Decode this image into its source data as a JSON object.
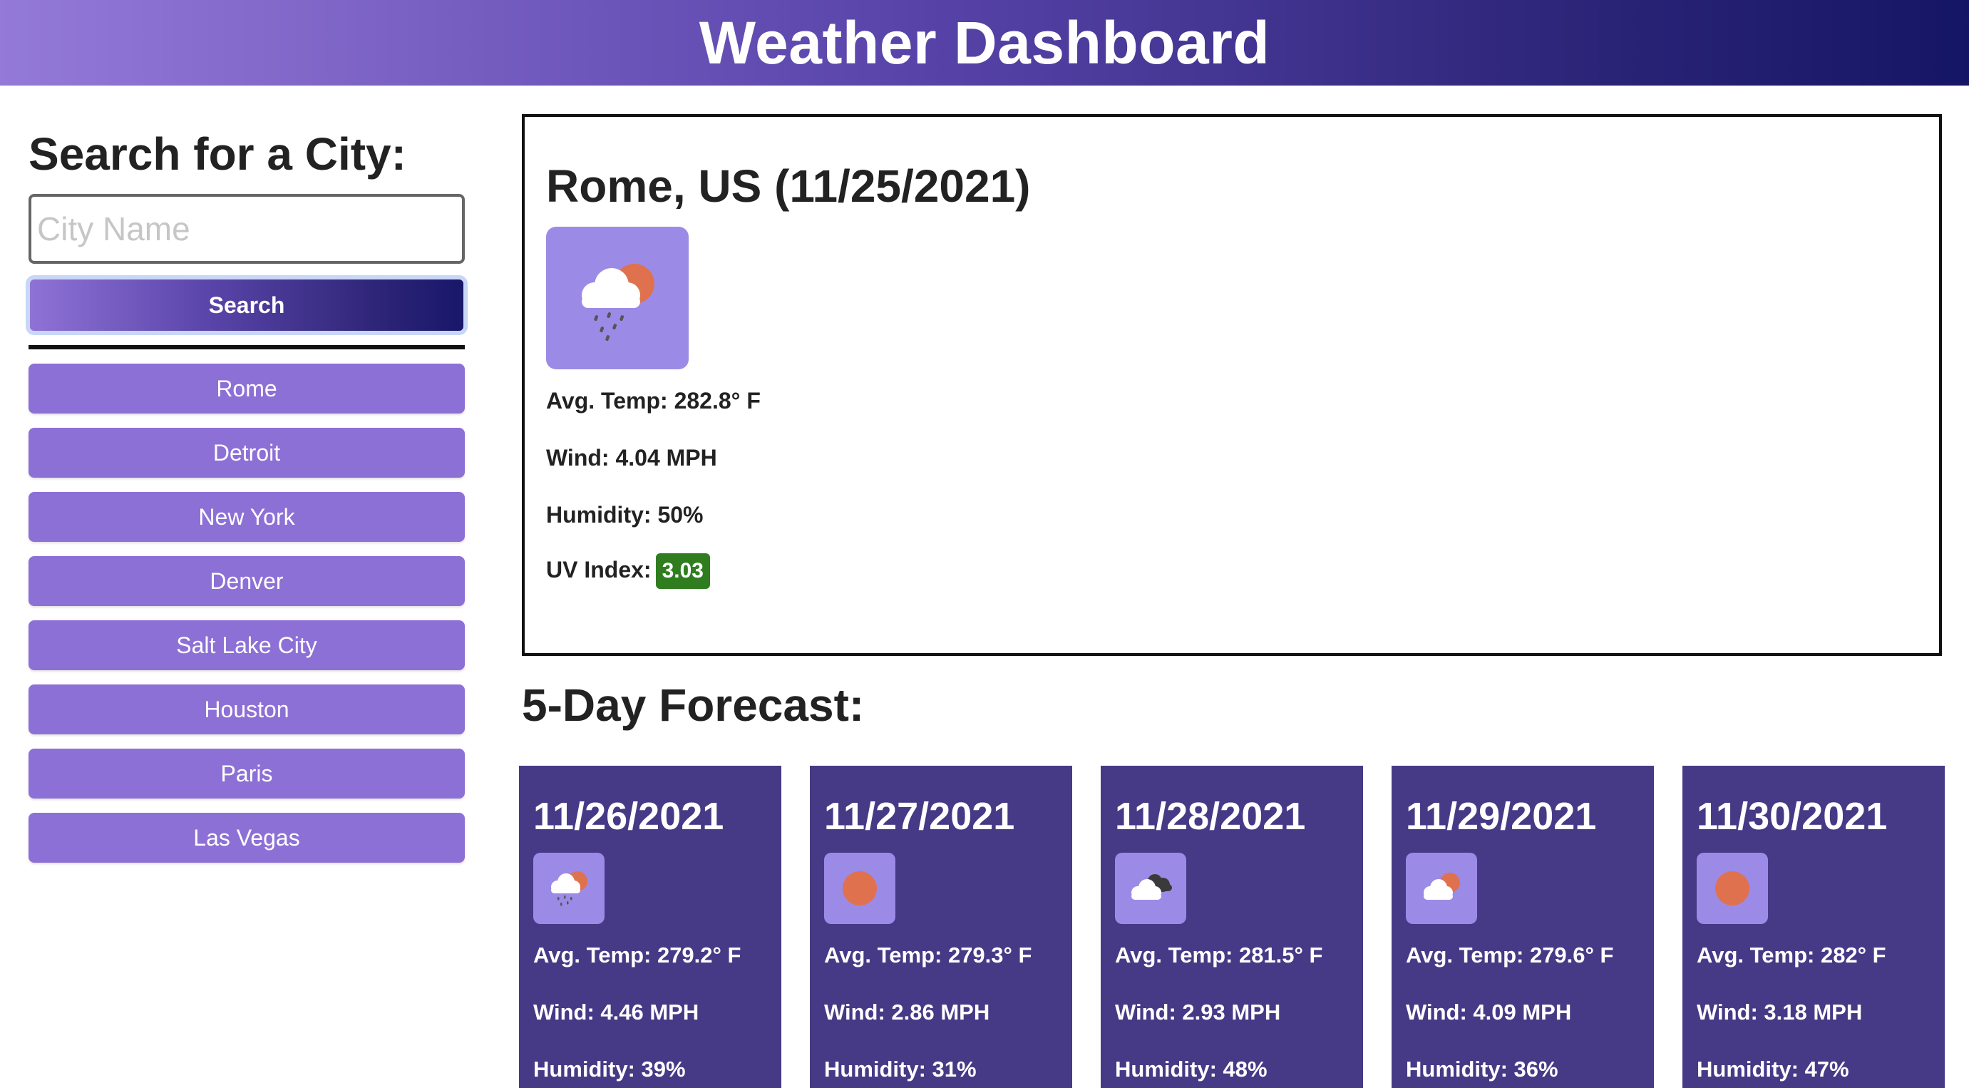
{
  "header": {
    "title": "Weather Dashboard"
  },
  "sidebar": {
    "heading": "Search for a City:",
    "input_placeholder": "City Name",
    "input_value": "",
    "search_label": "Search",
    "history": [
      "Rome",
      "Detroit",
      "New York",
      "Denver",
      "Salt Lake City",
      "Houston",
      "Paris",
      "Las Vegas"
    ]
  },
  "current": {
    "title": "Rome, US (11/25/2021)",
    "icon": "rain-sun-cloud-icon",
    "temp": "Avg. Temp: 282.8° F",
    "wind": "Wind: 4.04 MPH",
    "humidity": "Humidity: 50%",
    "uv_label": "UV Index:",
    "uv_value": "3.03",
    "uv_color": "#2f7d1f"
  },
  "forecast": {
    "title": "5-Day Forecast:",
    "days": [
      {
        "date": "11/26/2021",
        "icon": "rain-sun-cloud-icon",
        "temp": "Avg. Temp: 279.2° F",
        "wind": "Wind: 4.46 MPH",
        "humidity": "Humidity: 39%"
      },
      {
        "date": "11/27/2021",
        "icon": "sun-icon",
        "temp": "Avg. Temp: 279.3° F",
        "wind": "Wind: 2.86 MPH",
        "humidity": "Humidity: 31%"
      },
      {
        "date": "11/28/2021",
        "icon": "broken-clouds-icon",
        "temp": "Avg. Temp: 281.5° F",
        "wind": "Wind: 2.93 MPH",
        "humidity": "Humidity: 48%"
      },
      {
        "date": "11/29/2021",
        "icon": "partly-cloudy-icon",
        "temp": "Avg. Temp: 279.6° F",
        "wind": "Wind: 4.09 MPH",
        "humidity": "Humidity: 36%"
      },
      {
        "date": "11/30/2021",
        "icon": "sun-icon",
        "temp": "Avg. Temp: 282° F",
        "wind": "Wind: 3.18 MPH",
        "humidity": "Humidity: 47%"
      }
    ]
  },
  "colors": {
    "accent": "#8d70d6",
    "card_bg": "#463a86",
    "icon_tile": "#9b8be6",
    "sun": "#e0714f"
  }
}
